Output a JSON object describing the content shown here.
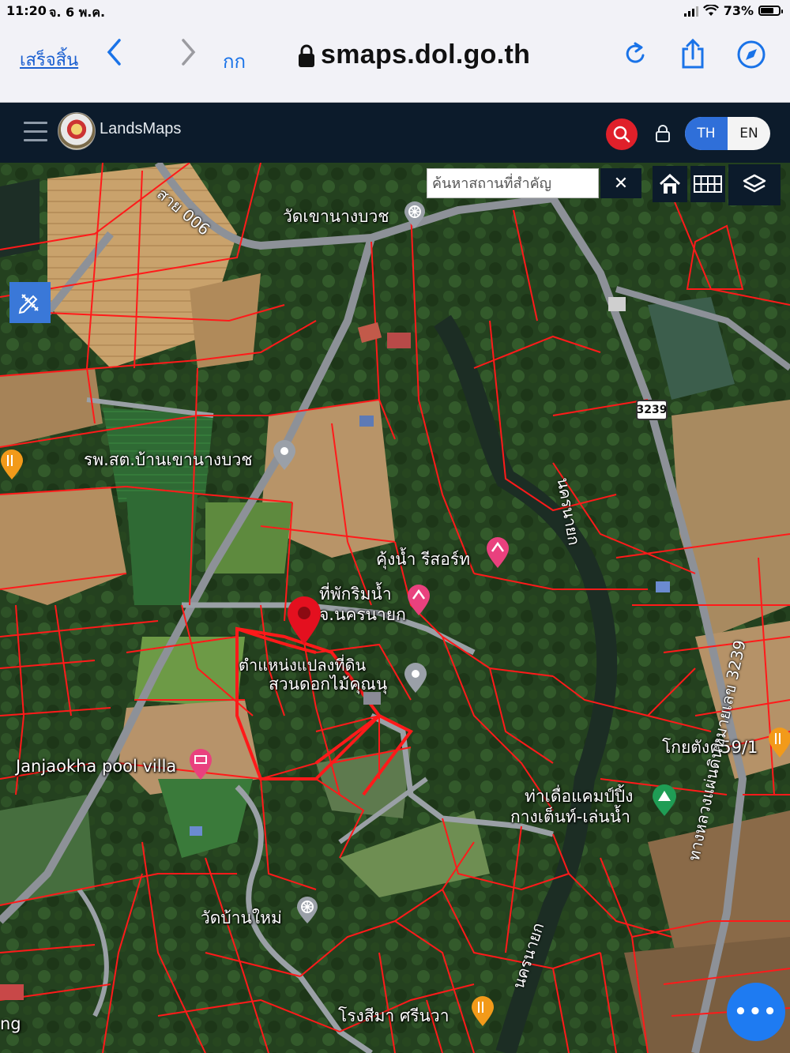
{
  "status_bar": {
    "time": "11:20",
    "date": "จ. 6 พ.ค.",
    "battery_text": "73%",
    "battery_level": 0.73
  },
  "browser": {
    "done_label": "เสร็จสิ้น",
    "text_size_label": "กก",
    "url": "smaps.dol.go.th"
  },
  "header": {
    "brand": "LandsMaps",
    "lang_th": "TH",
    "lang_en": "EN"
  },
  "map": {
    "search_placeholder": "ค้นหาสถานที่สำคัญ",
    "clear_label": "✕",
    "more_label": "•••",
    "labels": {
      "road_top": "สาย 006",
      "temple_top": "วัดเขานางบวช",
      "hospital": "รพ.สต.บ้านเขานางบวช",
      "resort": "คุ้งน้ำ รีสอร์ท",
      "lodge_line1": "ที่พักริมน้ำ",
      "lodge_line2": "จ.นครนายก",
      "parcel_line1": "ตำแหน่งแปลงที่ดิน",
      "parcel_line2": "สวนดอกไม้คุณนุ",
      "pool_villa": "Janjaokha pool villa",
      "kaeng": "โกยตังค์59/1",
      "camp_line1": "ท่าเดื่อแคมป์ปิ้ง",
      "camp_line2": "กางเต็นท์-เล่นน้ำ",
      "temple_bottom": "วัดบ้านใหม่",
      "factory": "โรงสีมา ศรีนวา",
      "river_top": "นครนายก",
      "river_bottom": "นครนายก",
      "highway_sign": "3239",
      "highway_long": "ทางหลวงแผ่นดินหมายเลข 3239",
      "edge_left": "ng"
    }
  },
  "colors": {
    "parcel_line": "#ff1a1a",
    "header_bg": "#0c1b2b",
    "lang_active": "#2f6fd9",
    "search_red": "#e0202a",
    "fab_blue": "#1e7bf2"
  }
}
